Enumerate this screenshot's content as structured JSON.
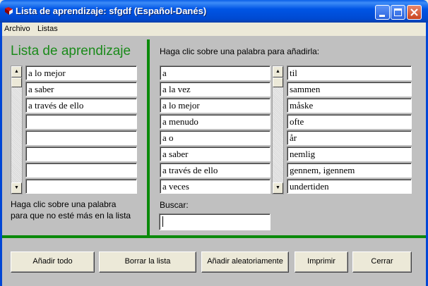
{
  "window": {
    "title": "Lista de aprendizaje: sfgdf (Español-Danés)",
    "title_icon": "book-icon",
    "controls": [
      "minimize-icon",
      "maximize-icon",
      "close-icon"
    ]
  },
  "menu": [
    "Archivo",
    "Listas"
  ],
  "learning_list": {
    "heading": "Lista de aprendizaje",
    "items": [
      "a lo mejor",
      "a saber",
      "a través de ello",
      "",
      "",
      "",
      "",
      ""
    ],
    "instruction_line1": "Haga clic sobre una palabra",
    "instruction_line2": "para que no esté más en la lista"
  },
  "dictionary": {
    "instruction": "Haga clic sobre una palabra para añadirla:",
    "spanish": [
      "a",
      "a la vez",
      "a lo mejor",
      "a menudo",
      "a o",
      "a saber",
      "a través de ello",
      "a veces"
    ],
    "danish": [
      "til",
      "sammen",
      "måske",
      "ofte",
      "år",
      "nemlig",
      "gennem, igennem",
      "undertiden"
    ],
    "search_label": "Buscar:",
    "search_value": ""
  },
  "buttons": {
    "add_all": "Añadir todo",
    "clear_list": "Borrar la lista",
    "add_random": "Añadir aleatoriamente",
    "print": "Imprimir",
    "close": "Cerrar"
  },
  "colors": {
    "accent_green": "#1a8a1a",
    "titlebar_blue": "#0055e5",
    "panel_gray": "#c0c0c0"
  }
}
